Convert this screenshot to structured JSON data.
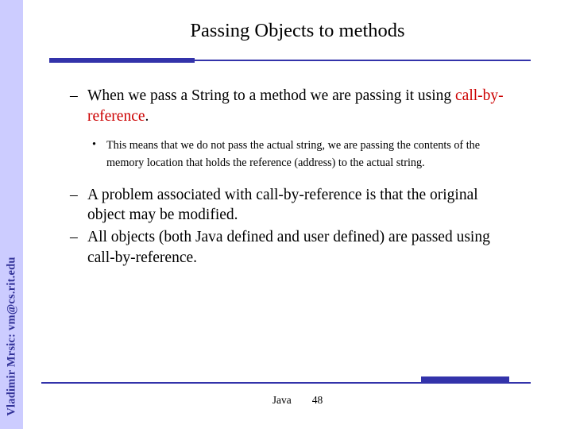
{
  "slide": {
    "title": "Passing Objects to methods",
    "sidebar_text": "Vladimir Mrsic: vm@cs.rit.edu",
    "accent_color": "#3333aa",
    "sidebar_color": "#ccccff",
    "highlight_color": "#cc0000",
    "bullets": [
      {
        "level": 1,
        "marker": "–",
        "segments": [
          {
            "text": "When we pass a String to a method we are passing it using ",
            "highlight": false
          },
          {
            "text": "call-by-reference",
            "highlight": true
          },
          {
            "text": ".",
            "highlight": false
          }
        ]
      },
      {
        "level": 2,
        "marker": "•",
        "segments": [
          {
            "text": "This means that we do not pass the actual string, we are passing the contents of the memory location that holds the reference (address) to the actual string.",
            "highlight": false
          }
        ]
      },
      {
        "level": 1,
        "marker": "–",
        "segments": [
          {
            "text": "A problem associated with call-by-reference is that the original object may be modified.",
            "highlight": false
          }
        ]
      },
      {
        "level": 1,
        "marker": "–",
        "segments": [
          {
            "text": "All objects (both Java defined and user defined) are passed using call-by-reference.",
            "highlight": false
          }
        ]
      }
    ],
    "footer": {
      "label": "Java",
      "page_number": "48"
    }
  }
}
